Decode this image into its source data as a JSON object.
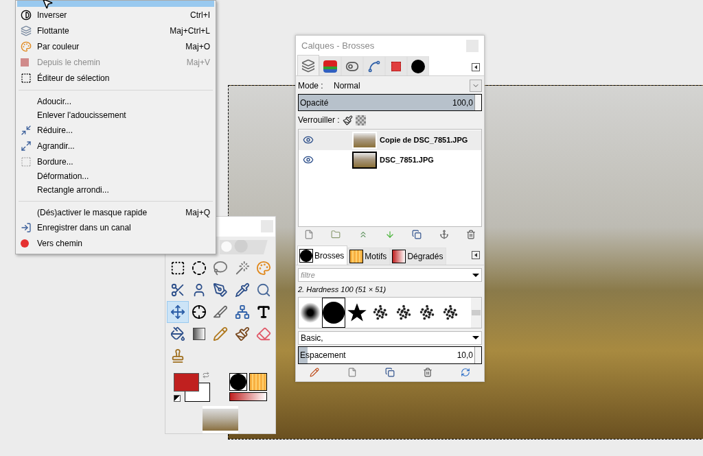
{
  "menu": {
    "items": [
      {
        "kind": "invert",
        "label": "Inverser",
        "shortcut": "Ctrl+I",
        "disabled": false
      },
      {
        "kind": "float",
        "label": "Flottante",
        "shortcut": "Maj+Ctrl+L",
        "disabled": false
      },
      {
        "kind": "bycolor",
        "label": "Par couleur",
        "shortcut": "Maj+O",
        "disabled": false
      },
      {
        "kind": "frompath",
        "label": "Depuis le chemin",
        "shortcut": "Maj+V",
        "disabled": true
      },
      {
        "kind": "editor",
        "label": "Éditeur de sélection",
        "disabled": false
      },
      {
        "kind": "separator"
      },
      {
        "kind": "plain",
        "label": "Adoucir...",
        "disabled": false
      },
      {
        "kind": "plain",
        "label": "Enlever l'adoucissement",
        "disabled": false
      },
      {
        "kind": "shrink",
        "label": "Réduire...",
        "disabled": false
      },
      {
        "kind": "grow",
        "label": "Agrandir...",
        "disabled": false
      },
      {
        "kind": "border",
        "label": "Bordure...",
        "disabled": false
      },
      {
        "kind": "plain",
        "label": "Déformation...",
        "disabled": false
      },
      {
        "kind": "plain",
        "label": "Rectangle arrondi...",
        "disabled": false
      },
      {
        "kind": "separator"
      },
      {
        "kind": "plain",
        "label": "(Dés)activer le masque rapide",
        "shortcut": "Maj+Q",
        "disabled": false
      },
      {
        "kind": "tochannel",
        "label": "Enregistrer dans un canal",
        "disabled": false
      },
      {
        "kind": "topath",
        "label": "Vers chemin",
        "disabled": false
      }
    ]
  },
  "dialog": {
    "title": "Calques - Brosses",
    "tabs": [
      {
        "kind": "layers",
        "selected": true
      },
      {
        "kind": "channels",
        "selected": false
      },
      {
        "kind": "device",
        "selected": false
      },
      {
        "kind": "paths",
        "selected": false
      },
      {
        "kind": "selection",
        "selected": false
      },
      {
        "kind": "brush",
        "selected": false
      }
    ],
    "mode": {
      "label": "Mode :",
      "value": "Normal"
    },
    "opacity": {
      "label": "Opacité",
      "value": "100,0",
      "level": 1
    },
    "lock": {
      "label": "Verrouiller :"
    },
    "layers": [
      {
        "name": "Copie de DSC_7851.JPG",
        "visible": true,
        "selected": true,
        "framed": false
      },
      {
        "name": "DSC_7851.JPG",
        "visible": true,
        "selected": false,
        "framed": true
      }
    ],
    "brush_tabs": [
      {
        "kind": "brush",
        "label": "Brosses",
        "selected": true
      },
      {
        "kind": "pattern",
        "label": "Motifs",
        "selected": false
      },
      {
        "kind": "gradient",
        "label": "Dégradés",
        "selected": false
      }
    ],
    "filter": {
      "placeholder": "filtre"
    },
    "brush_name": "2. Hardness 100 (51 × 51)",
    "brushes": [
      {
        "kind": "soft",
        "selected": false
      },
      {
        "kind": "hard",
        "selected": true
      },
      {
        "kind": "star",
        "selected": false
      },
      {
        "kind": "splatter",
        "selected": false
      },
      {
        "kind": "splatter",
        "selected": false
      },
      {
        "kind": "splatter",
        "selected": false
      },
      {
        "kind": "splatter",
        "selected": false
      }
    ],
    "brush_set": "Basic,",
    "spacing": {
      "label": "Espacement",
      "value": "10,0",
      "level": 0.05
    }
  },
  "toolbox": {
    "tools": [
      {
        "kind": "rect-select",
        "selected": false
      },
      {
        "kind": "ellipse-select",
        "selected": false
      },
      {
        "kind": "lasso",
        "selected": false
      },
      {
        "kind": "wand",
        "selected": false
      },
      {
        "kind": "by-color",
        "selected": false
      },
      {
        "kind": "scissors",
        "selected": false
      },
      {
        "kind": "foreground",
        "selected": false
      },
      {
        "kind": "paths",
        "selected": false
      },
      {
        "kind": "picker",
        "selected": false
      },
      {
        "kind": "zoom",
        "selected": false
      },
      {
        "kind": "move",
        "selected": true
      },
      {
        "kind": "align",
        "selected": false
      },
      {
        "kind": "blade",
        "selected": false
      },
      {
        "kind": "cage",
        "selected": false
      },
      {
        "kind": "text",
        "selected": false
      },
      {
        "kind": "bucket",
        "selected": false
      },
      {
        "kind": "gradient",
        "selected": false
      },
      {
        "kind": "pencil",
        "selected": false
      },
      {
        "kind": "brush",
        "selected": false
      },
      {
        "kind": "eraser",
        "selected": false
      },
      {
        "kind": "stamp",
        "selected": false
      }
    ]
  }
}
